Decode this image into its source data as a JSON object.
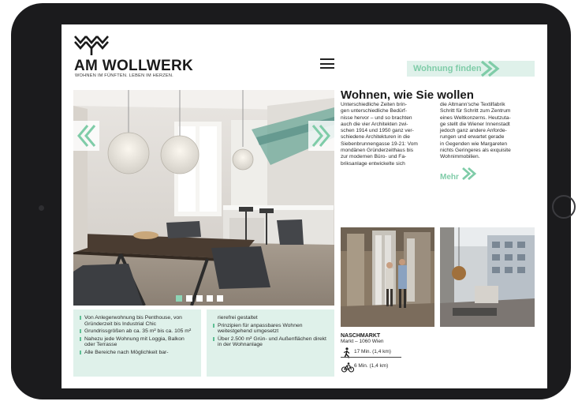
{
  "header": {
    "logo_text": "AM WOLLWERK",
    "tagline": "WOHNEN IM FÜNFTEN. LEBEN IM HERZEN.",
    "find_button_label": "Wohnung finden",
    "menu_icon": "hamburger-icon"
  },
  "hero": {
    "slide_count": 5,
    "active_slide": 1,
    "prev_icon": "chevron-left-icon",
    "next_icon": "chevron-right-icon"
  },
  "article": {
    "title": "Wohnen, wie Sie wollen",
    "col1": [
      "Unterschiedliche Zeiten brin-",
      "gen unterschiedliche Bedürf-",
      "nisse hervor – und so brachten",
      "auch die vier Architekten zwi-",
      "schen 1914 und 1950 ganz ver-",
      "schiedene Architekturen in die",
      "Siebenbrunnengasse 19-21: Vom",
      "mondänen Gründerzeithaus bis",
      "zur modernen Büro- und Fa-",
      "briksanlage entwickelte sich"
    ],
    "col2": [
      "die Altmann'sche Textilfabrik",
      "Schritt für Schritt zum Zentrum",
      "eines Weltkonzerns. Heutzuta-",
      "ge stellt die Wiener Innenstadt",
      "jedoch ganz andere Anforde-",
      "rungen und erwartet gerade",
      "in Gegenden wie Margareten",
      "nichts Geringeres als exquisite",
      "Wohnimmobilien."
    ],
    "more_label": "Mehr"
  },
  "features": {
    "left": [
      "Von Anlegerwohnung bis Penthouse, von Gründerzeit bis Industrial Chic",
      "Grundrissgrößen ab ca. 35 m² bis ca. 105 m²",
      "Nahezu jede Wohnung mit Loggia, Balkon oder Terrasse",
      "Alle Bereiche nach Möglichkeit bar-"
    ],
    "right": [
      "rierefrei gestaltet",
      "Prinzipien für anpassbares Wohnen weitestgehend umgesetzt",
      "Über 2.500 m² Grün- und Außenflächen direkt in der Wohnanlage"
    ]
  },
  "location": {
    "title": "NASCHMARKT",
    "subtitle": "Markt – 1060 Wien",
    "walk_icon": "walking-icon",
    "walk": "17 Min. (1,4 km)",
    "bike_icon": "bicycle-icon",
    "bike": "6 Min. (1,4 km)"
  },
  "colors": {
    "accent": "#7fcca8",
    "accent_light": "#dff1ea",
    "bezel": "#1b1b1d",
    "text": "#1a1a1a"
  }
}
